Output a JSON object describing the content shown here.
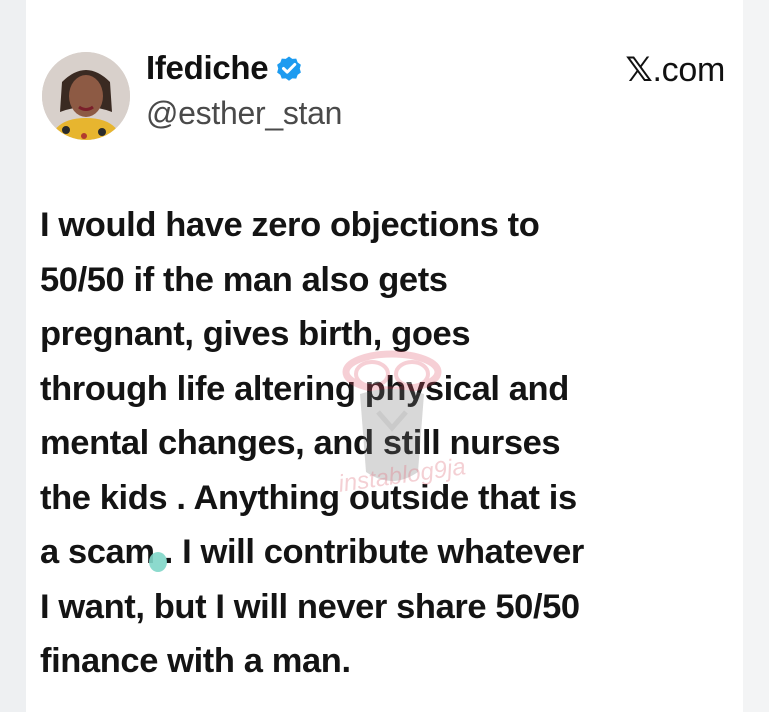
{
  "author": {
    "display_name": "Ifediche",
    "handle": "@esther_stan",
    "verified": true
  },
  "source": {
    "glyph": "𝕏",
    "text": ".com"
  },
  "tweet": {
    "text": "I would have zero objections to\n50/50 if the man also gets\npregnant, gives birth, goes\nthrough life altering physical and\nmental changes, and still nurses\nthe kids . Anything outside that is\na scam . I will contribute whatever\nI want, but I will never share 50/50\nfinance with a man."
  },
  "watermark": {
    "text": "instablog9ja"
  },
  "colors": {
    "verified_badge": "#1d9bf0",
    "text": "#141414",
    "handle": "#4a4a4a",
    "watermark": "#e27a86"
  },
  "icons": {
    "verified": "verified-badge-icon",
    "avatar": "profile-avatar"
  }
}
